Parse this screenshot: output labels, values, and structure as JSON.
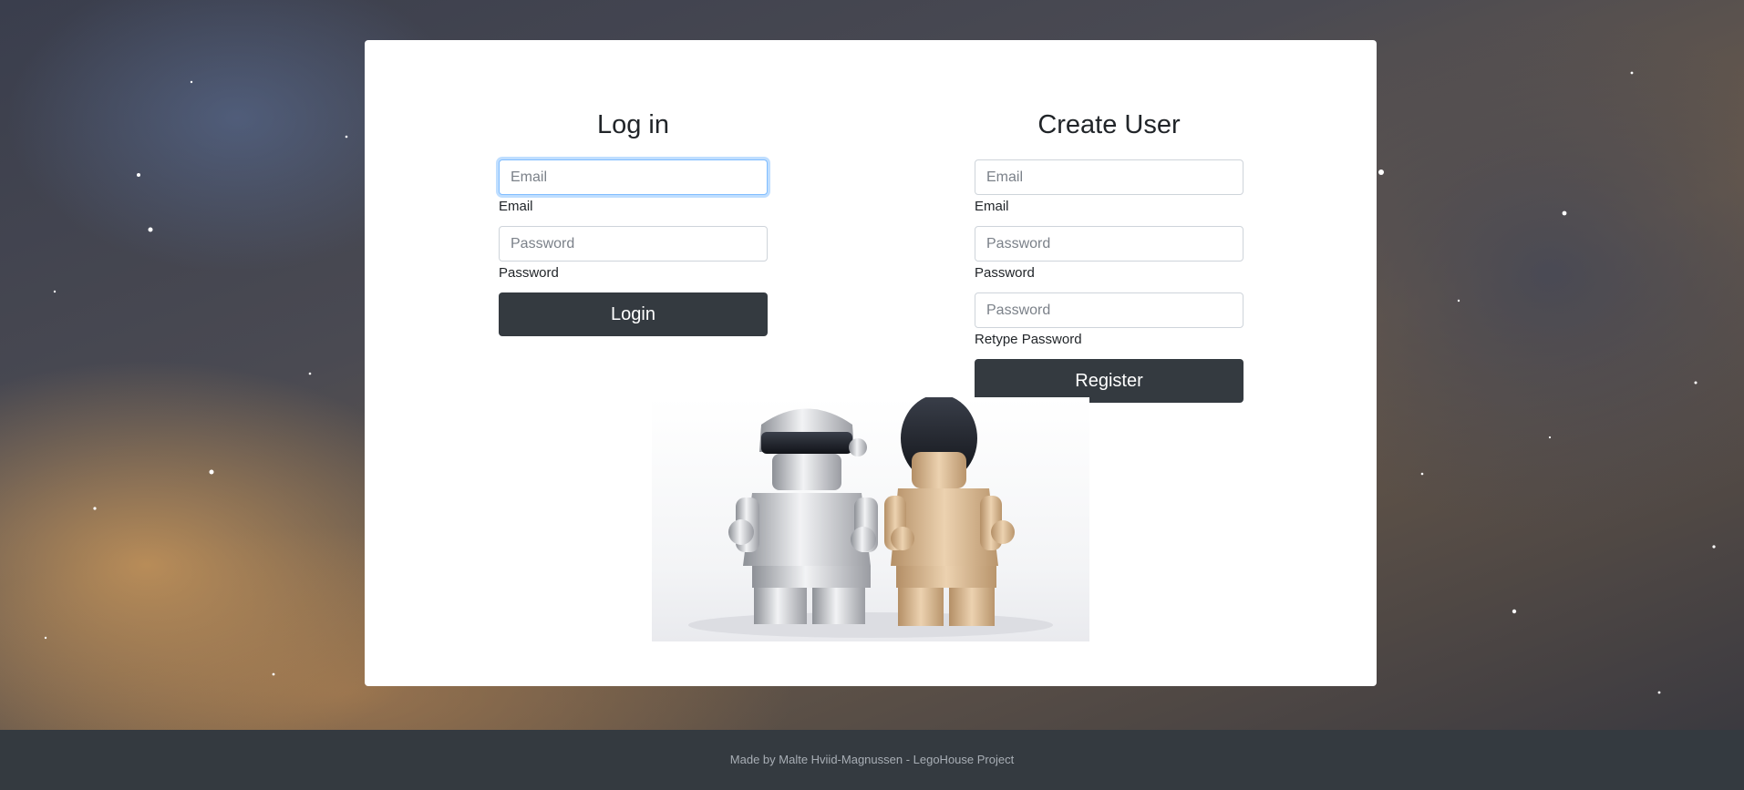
{
  "login": {
    "title": "Log in",
    "email_placeholder": "Email",
    "email_label": "Email",
    "password_placeholder": "Password",
    "password_label": "Password",
    "button_label": "Login"
  },
  "register": {
    "title": "Create User",
    "email_placeholder": "Email",
    "email_label": "Email",
    "password_placeholder": "Password",
    "password_label": "Password",
    "retype_placeholder": "Password",
    "retype_label": "Retype Password",
    "button_label": "Register"
  },
  "footer": {
    "text": "Made by Malte Hviid-Magnussen - LegoHouse Project"
  },
  "colors": {
    "button_bg": "#343a40",
    "footer_bg": "#343a40",
    "focus_border": "#80bdff"
  }
}
